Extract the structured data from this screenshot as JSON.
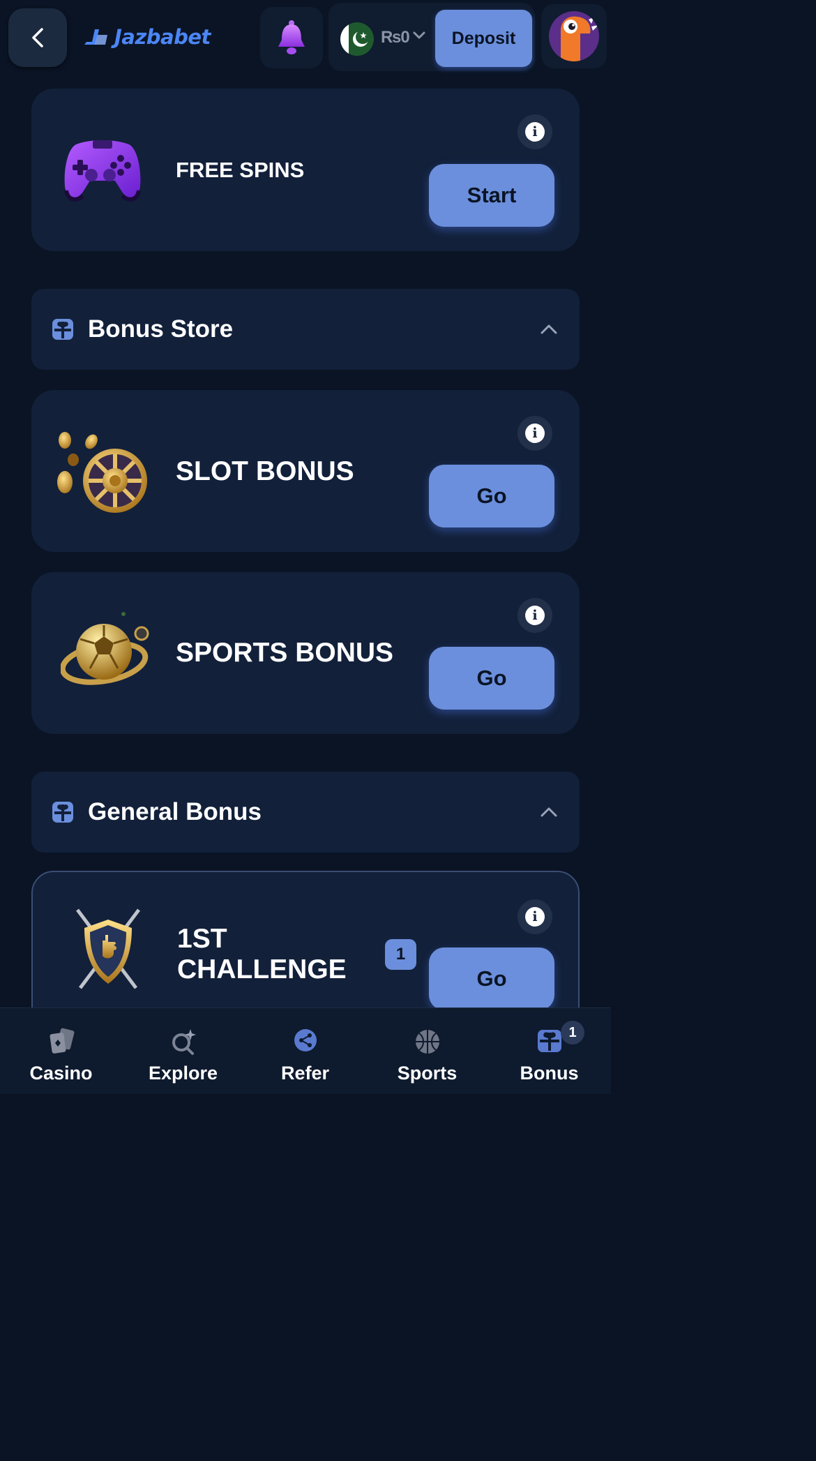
{
  "header": {
    "logo_text": "Jazbabet",
    "currency_symbol_balance": "₨0",
    "deposit_label": "Deposit",
    "icons": [
      "back-chevron-icon",
      "bell-icon",
      "pakistan-flag-icon",
      "chevron-down-icon",
      "avatar-dino-icon"
    ]
  },
  "free_spins": {
    "title": "FREE SPINS",
    "button": "Start",
    "info": "i",
    "art": "gamepad-icon"
  },
  "bonus_store": {
    "title": "Bonus Store",
    "icon": "gift-icon",
    "items": [
      {
        "title": "SLOT BONUS",
        "button": "Go",
        "info": "i",
        "art": "roulette-coins-icon"
      },
      {
        "title": "SPORTS BONUS",
        "button": "Go",
        "info": "i",
        "art": "football-globe-icon"
      }
    ]
  },
  "general_bonus": {
    "title": "General Bonus",
    "icon": "gift-icon",
    "items": [
      {
        "title_line1": "1ST",
        "title_line2": "CHALLENGE",
        "badge": "1",
        "button": "Go",
        "info": "i",
        "art": "shield-swords-icon"
      }
    ]
  },
  "bottom_nav": {
    "items": [
      {
        "label": "Casino",
        "icon": "cards-icon"
      },
      {
        "label": "Explore",
        "icon": "explore-icon"
      },
      {
        "label": "Refer",
        "icon": "share-icon"
      },
      {
        "label": "Sports",
        "icon": "basketball-icon"
      },
      {
        "label": "Bonus",
        "icon": "gift-icon",
        "badge": "1"
      }
    ]
  },
  "colors": {
    "background": "#0a1424",
    "card": "#12203a",
    "accent_button": "#6b8fdc",
    "logo_blue": "#4c86f5"
  }
}
